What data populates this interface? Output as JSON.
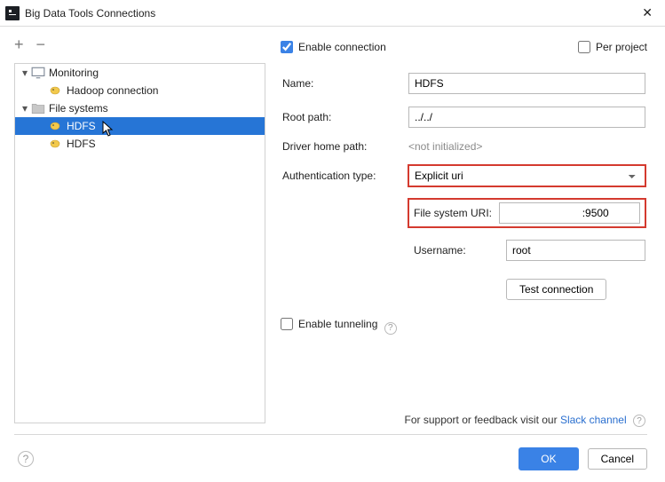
{
  "window": {
    "title": "Big Data Tools Connections",
    "close": "✕"
  },
  "toolbar": {
    "add": "+",
    "remove": "−"
  },
  "tree": {
    "monitoring": {
      "label": "Monitoring"
    },
    "hadoop_conn": {
      "label": "Hadoop connection"
    },
    "file_systems": {
      "label": "File systems"
    },
    "hdfs1": {
      "label": "HDFS"
    },
    "hdfs2": {
      "label": "HDFS"
    }
  },
  "form": {
    "enable_connection": "Enable connection",
    "per_project": "Per project",
    "name_label": "Name:",
    "name_value": "HDFS",
    "root_path_label": "Root path:",
    "root_path_value": "../../",
    "driver_home_label": "Driver home path:",
    "driver_home_value": "<not initialized>",
    "auth_type_label": "Authentication type:",
    "auth_type_value": "Explicit uri",
    "fs_uri_label": "File system URI:",
    "fs_uri_value": "                          :9500",
    "username_label": "Username:",
    "username_value": "root",
    "test_button": "Test connection",
    "enable_tunneling": "Enable tunneling"
  },
  "support": {
    "prefix": "For support or feedback visit our ",
    "link": "Slack channel"
  },
  "footer": {
    "ok": "OK",
    "cancel": "Cancel"
  }
}
